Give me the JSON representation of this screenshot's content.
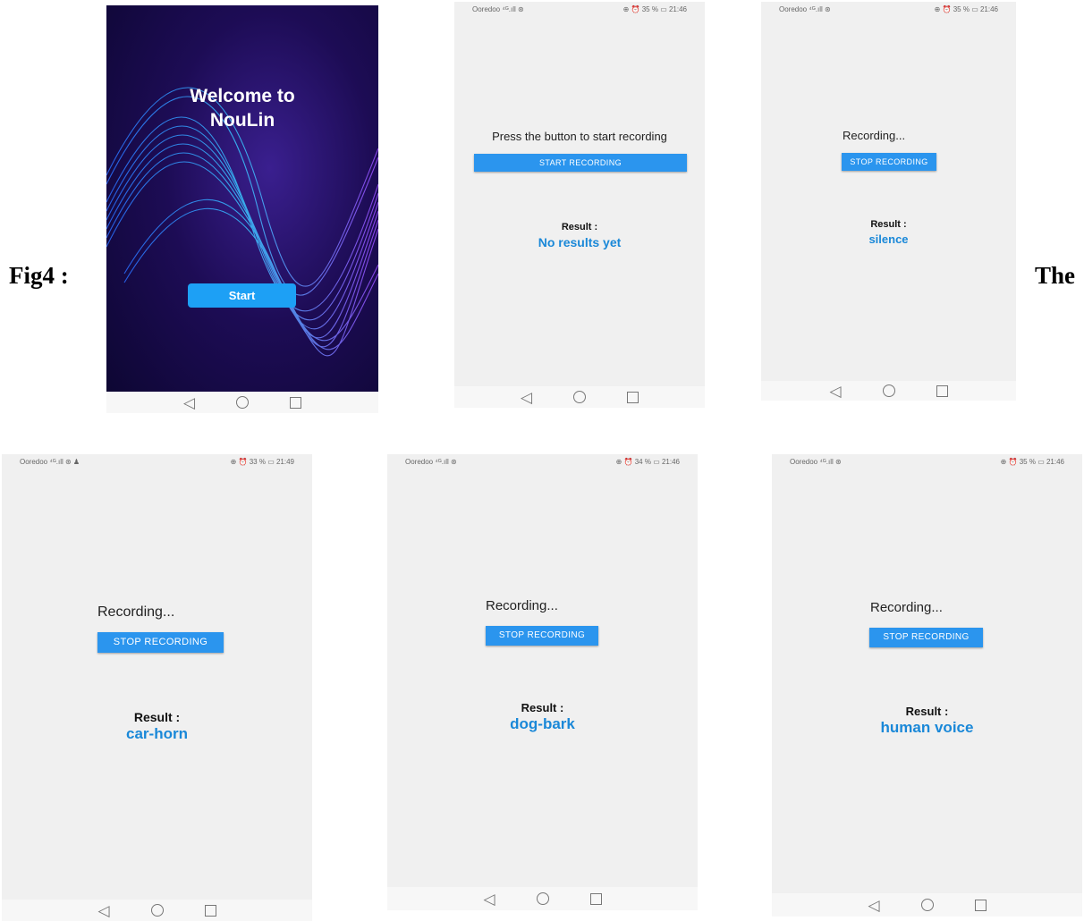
{
  "caption": {
    "left": "Fig4 :",
    "right": "The"
  },
  "nav": {
    "back": "◁"
  },
  "splash": {
    "welcome_line1": "Welcome to",
    "welcome_line2": "NouLin",
    "start_label": "Start"
  },
  "screen2": {
    "status_left": "Ooredoo ⁴ᴳ.ıll ⊛",
    "status_right": "⊕ ⏰ 35 % ▭ 21:46",
    "prompt": "Press the button to start recording",
    "button": "START RECORDING",
    "result_label": "Result :",
    "result_value": "No results yet"
  },
  "screen3": {
    "status_left": "Ooredoo ⁴ᴳ.ıll ⊛",
    "status_right": "⊕ ⏰ 35 % ▭ 21:46",
    "status_text": "Recording...",
    "button": "STOP RECORDING",
    "result_label": "Result :",
    "result_value": "silence"
  },
  "screen4": {
    "status_left": "Ooredoo ⁴ᴳ.ıll ⊛ ♟",
    "status_right": "⊕ ⏰ 33 % ▭ 21:49",
    "status_text": "Recording...",
    "button": "STOP RECORDING",
    "result_label": "Result :",
    "result_value": "car-horn"
  },
  "screen5": {
    "status_left": "Ooredoo ⁴ᴳ.ıll ⊛",
    "status_right": "⊕ ⏰ 34 % ▭ 21:46",
    "status_text": "Recording...",
    "button": "STOP RECORDING",
    "result_label": "Result :",
    "result_value": "dog-bark"
  },
  "screen6": {
    "status_left": "Ooredoo ⁴ᴳ.ıll ⊛",
    "status_right": "⊕ ⏰ 35 % ▭ 21:46",
    "status_text": "Recording...",
    "button": "STOP RECORDING",
    "result_label": "Result :",
    "result_value": "human voice"
  }
}
